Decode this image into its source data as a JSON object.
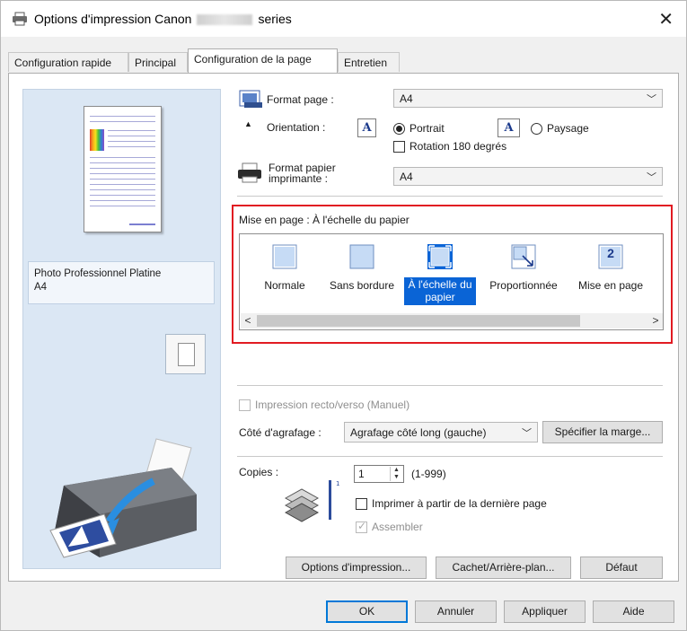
{
  "window": {
    "title_prefix": "Options d'impression Canon",
    "title_suffix": "series",
    "close_glyph": "✕"
  },
  "tabs": [
    {
      "label": "Configuration rapide"
    },
    {
      "label": "Principal"
    },
    {
      "label": "Configuration de la page"
    },
    {
      "label": "Entretien"
    }
  ],
  "preview": {
    "media_line1": "Photo Professionnel Platine",
    "media_line2": "A4"
  },
  "page_size": {
    "label": "Format page :",
    "value": "A4"
  },
  "orientation": {
    "label": "Orientation :",
    "portrait_label": "Portrait",
    "landscape_label": "Paysage",
    "rotate_label": "Rotation 180 degrés",
    "icon_glyph": "A",
    "selected": "Portrait"
  },
  "printer_paper": {
    "label_line1": "Format papier",
    "label_line2": "imprimante :",
    "value": "A4"
  },
  "layout": {
    "label": "Mise en page : À l'échelle du papier",
    "items": [
      {
        "label": "Normale"
      },
      {
        "label": "Sans bordure"
      },
      {
        "label_line1": "À l'échelle du",
        "label_line2": "papier",
        "selected": true
      },
      {
        "label": "Proportionnée"
      },
      {
        "label": "Mise en page",
        "badge": "2"
      }
    ],
    "scroll_left": "<",
    "scroll_right": ">"
  },
  "duplex": {
    "label": "Impression recto/verso (Manuel)"
  },
  "stapling": {
    "label": "Côté d'agrafage :",
    "value": "Agrafage côté long (gauche)",
    "margin_button": "Spécifier la marge..."
  },
  "copies": {
    "label": "Copies :",
    "value": "1",
    "range": "(1-999)",
    "reverse_label": "Imprimer à partir de la dernière page",
    "collate_label": "Assembler"
  },
  "panel_buttons": {
    "print_options": "Options d'impression...",
    "stamp_background": "Cachet/Arrière-plan...",
    "default": "Défaut"
  },
  "footer": {
    "ok": "OK",
    "cancel": "Annuler",
    "apply": "Appliquer",
    "help": "Aide"
  },
  "colors": {
    "accent": "#0a64d6",
    "highlight_frame": "#e11b22",
    "preview_bg": "#dbe7f4"
  }
}
